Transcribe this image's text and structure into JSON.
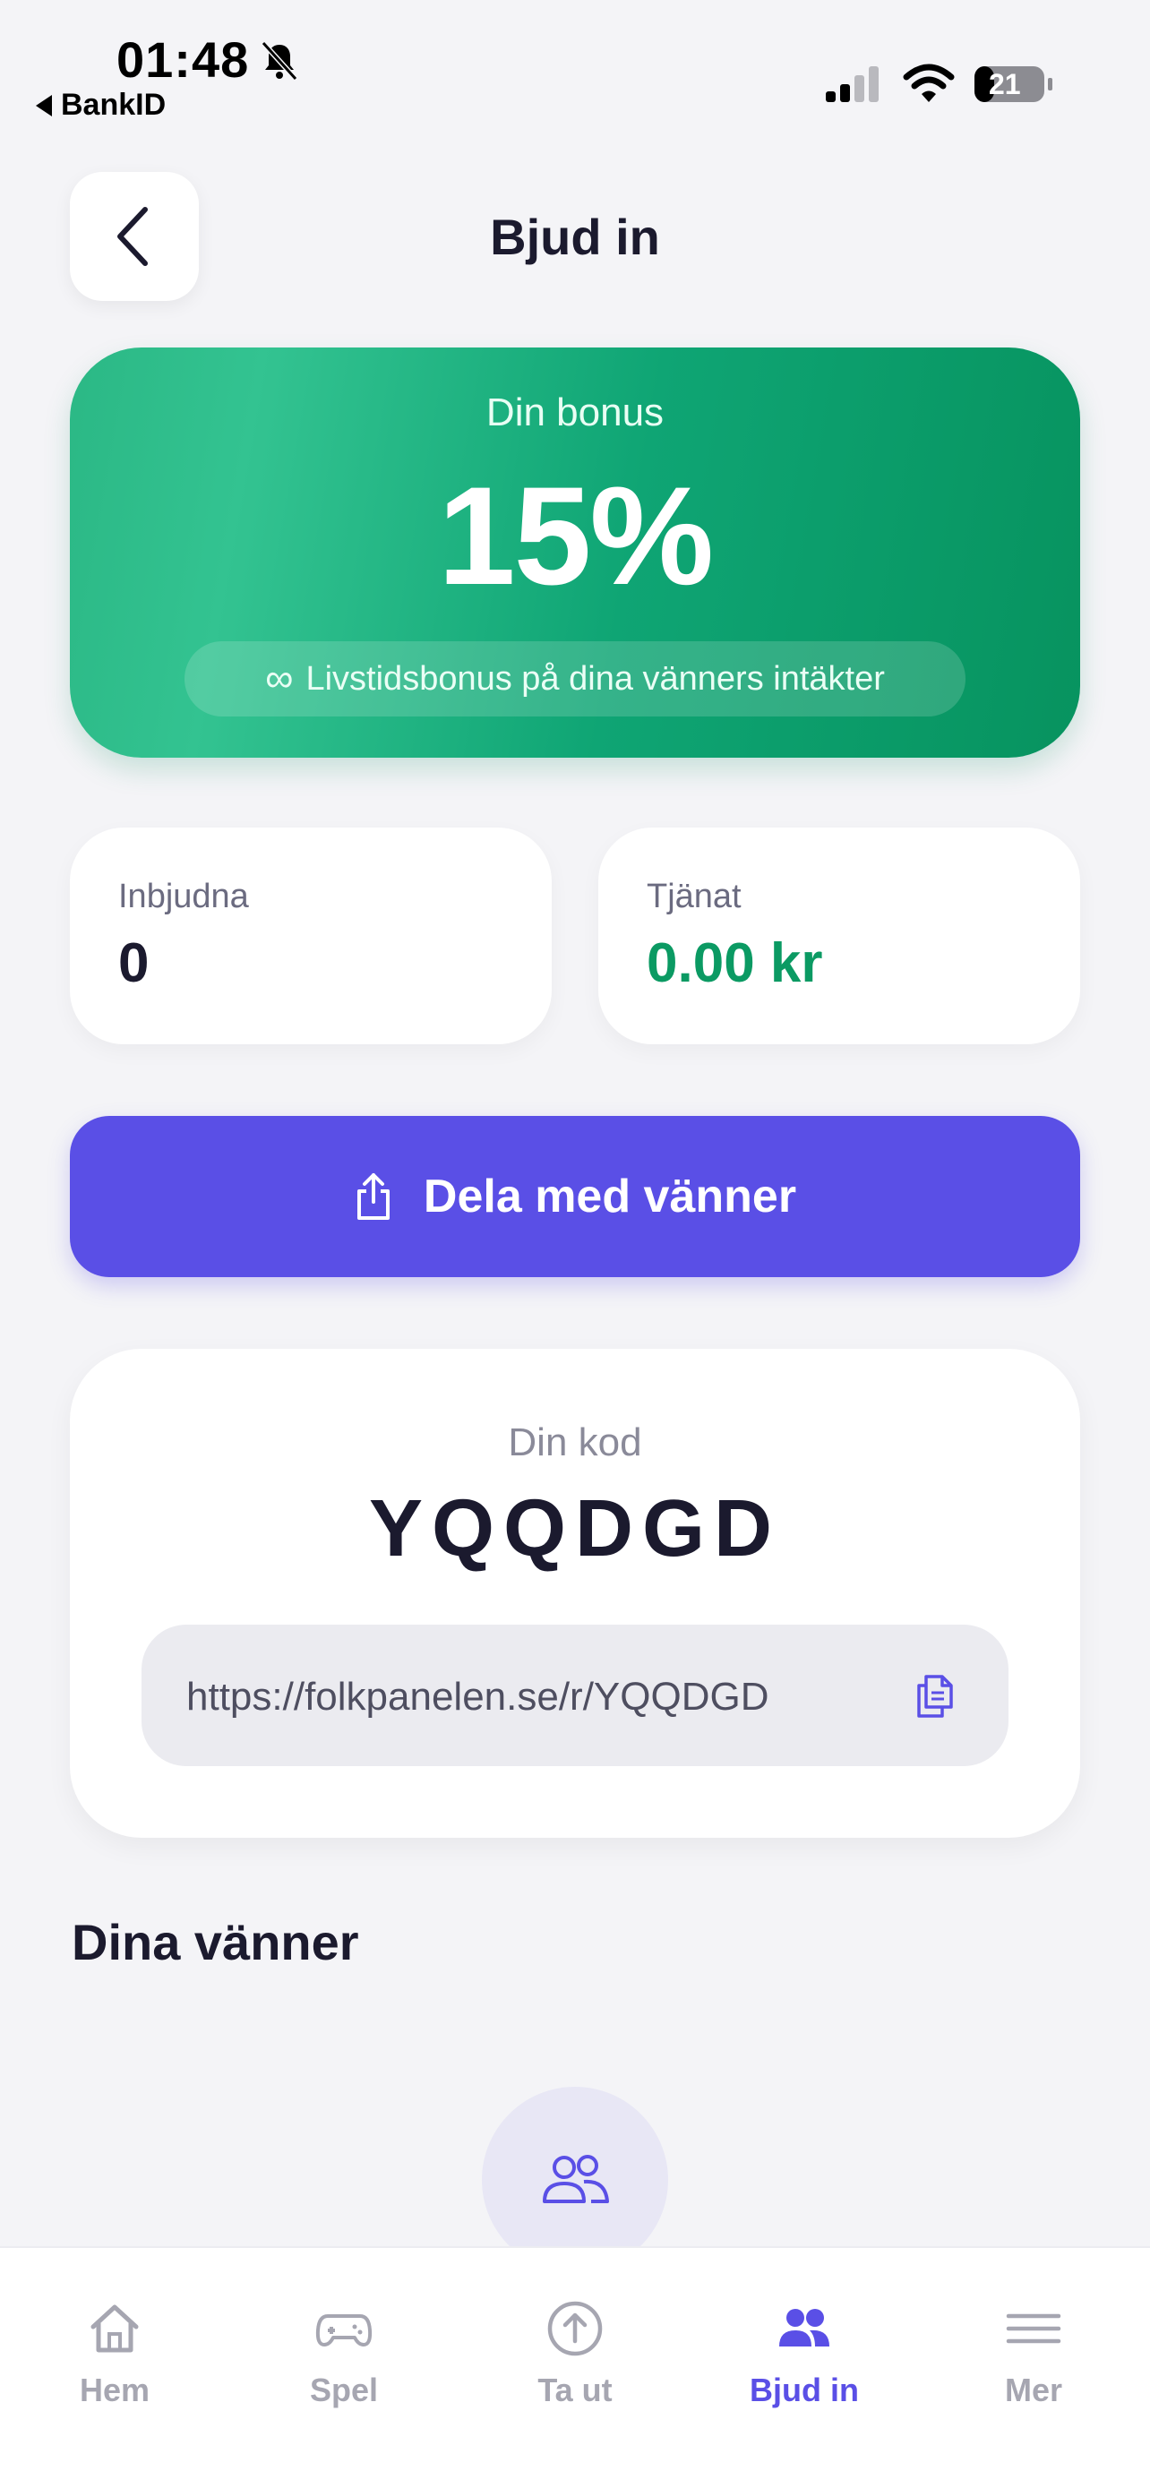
{
  "status_bar": {
    "time": "01:48",
    "back_app": "BankID",
    "battery": "21"
  },
  "header": {
    "title": "Bjud in"
  },
  "bonus": {
    "label": "Din bonus",
    "value": "15%",
    "note_icon": "∞",
    "note": "Livstidsbonus på dina vänners intäkter"
  },
  "stats": {
    "invited_label": "Inbjudna",
    "invited_value": "0",
    "earned_label": "Tjänat",
    "earned_value": "0.00 kr"
  },
  "share": {
    "label": "Dela med vänner"
  },
  "code": {
    "label": "Din kod",
    "value": "YQQDGD",
    "link": "https://folkpanelen.se/r/YQQDGD"
  },
  "friends": {
    "title": "Dina vänner"
  },
  "tabs": [
    {
      "label": "Hem",
      "icon": "home-icon",
      "active": false
    },
    {
      "label": "Spel",
      "icon": "gamepad-icon",
      "active": false
    },
    {
      "label": "Ta ut",
      "icon": "withdraw-icon",
      "active": false
    },
    {
      "label": "Bjud in",
      "icon": "invite-users-icon",
      "active": true
    },
    {
      "label": "Mer",
      "icon": "menu-icon",
      "active": false
    }
  ],
  "colors": {
    "accent": "#5a4fe6",
    "green": "#0b9a63",
    "background": "#f4f4f7"
  }
}
